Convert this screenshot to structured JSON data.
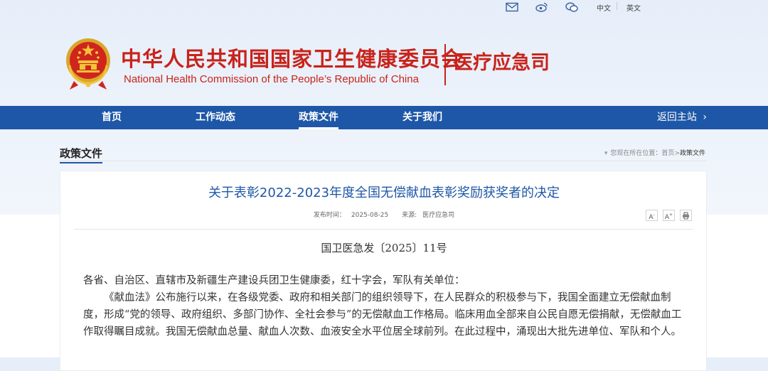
{
  "topbar": {
    "icons": [
      "mail-icon",
      "weibo-icon",
      "wechat-icon"
    ],
    "lang_cn": "中文",
    "lang_en": "英文"
  },
  "header": {
    "org_cn": "中华人民共和国国家卫生健康委员会",
    "org_en": "National Health Commission of the People’s Republic of China",
    "dept": "医疗应急司"
  },
  "nav": {
    "items": [
      {
        "label": "首页"
      },
      {
        "label": "工作动态"
      },
      {
        "label": "政策文件"
      },
      {
        "label": "关于我们"
      }
    ],
    "active_index": 2,
    "home_link": "返回主站"
  },
  "section": {
    "title": "政策文件",
    "breadcrumb_prefix": "您现在所在位置：",
    "breadcrumb_home": "首页",
    "breadcrumb_sep": ">",
    "breadcrumb_current": "政策文件"
  },
  "article": {
    "title": "关于表彰2022-2023年度全国无偿献血表彰奖励获奖者的决定",
    "publish_label": "发布时间：",
    "publish_date": "2025-08-25",
    "source_label": "来源:",
    "source": "医疗应急司",
    "tools": [
      "A-",
      "A+",
      "print"
    ],
    "doc_number": "国卫医急发〔2025〕11号",
    "paragraphs": [
      "各省、自治区、直辖市及新疆生产建设兵团卫生健康委，红十字会，军队有关单位：",
      "《献血法》公布施行以来，在各级党委、政府和相关部门的组织领导下，在人民群众的积极参与下，我国全面建立无偿献血制度，形成“党的领导、政府组织、多部门协作、全社会参与”的无偿献血工作格局。临床用血全部来自公民自愿无偿捐献，无偿献血工作取得瞩目成就。我国无偿献血总量、献血人次数、血液安全水平位居全球前列。在此过程中，涌现出大批先进单位、军队和个人。"
    ]
  },
  "colors": {
    "brand_red": "#c8231b",
    "nav_blue": "#1e57a7"
  }
}
